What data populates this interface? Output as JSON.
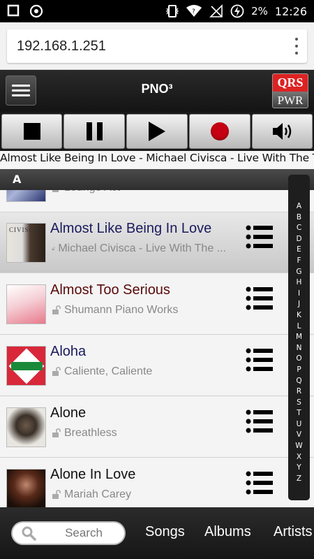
{
  "status_bar": {
    "battery": "2%",
    "time": "12:26",
    "icons": [
      "square-notification-icon",
      "circle-notification-icon",
      "vibrate-icon",
      "wifi-icon",
      "no-signal-icon",
      "battery-charging-icon"
    ]
  },
  "browser": {
    "url": "192.168.1.251",
    "menu_icon": "more-vert-icon"
  },
  "app": {
    "title": "PNO³",
    "logo_top": "QRS",
    "logo_bottom": "PWR"
  },
  "transport": {
    "buttons": [
      "stop-icon",
      "pause-icon",
      "play-icon",
      "record-icon",
      "volume-icon"
    ],
    "record_color": "#c40012"
  },
  "now_playing": "Almost Like Being In Love - Michael Civisca - Live With The Trio",
  "list": {
    "section_letter": "A",
    "partial_row_subtitle": "Lounge Act",
    "rows": [
      {
        "title": "Almost Like Being In Love",
        "subtitle": "Michael Civisca - Live With The ...",
        "title_color": "#1a1a5e",
        "selected": true
      },
      {
        "title": "Almost Too Serious",
        "subtitle": "Shumann Piano Works",
        "title_color": "#5a0a0a",
        "selected": false
      },
      {
        "title": "Aloha",
        "subtitle": "Caliente, Caliente",
        "title_color": "#1a1a5e",
        "selected": false
      },
      {
        "title": "Alone",
        "subtitle": "Breathless",
        "title_color": "#111111",
        "selected": false
      },
      {
        "title": "Alone In Love",
        "subtitle": "Mariah Carey",
        "title_color": "#111111",
        "selected": false
      }
    ]
  },
  "alphabet": [
    "A",
    "B",
    "C",
    "D",
    "E",
    "F",
    "G",
    "H",
    "I",
    "J",
    "K",
    "L",
    "M",
    "N",
    "O",
    "P",
    "Q",
    "R",
    "S",
    "T",
    "U",
    "V",
    "W",
    "X",
    "Y",
    "Z"
  ],
  "footer": {
    "search_placeholder": "Search",
    "tabs": [
      "Songs",
      "Albums",
      "Artists"
    ]
  }
}
